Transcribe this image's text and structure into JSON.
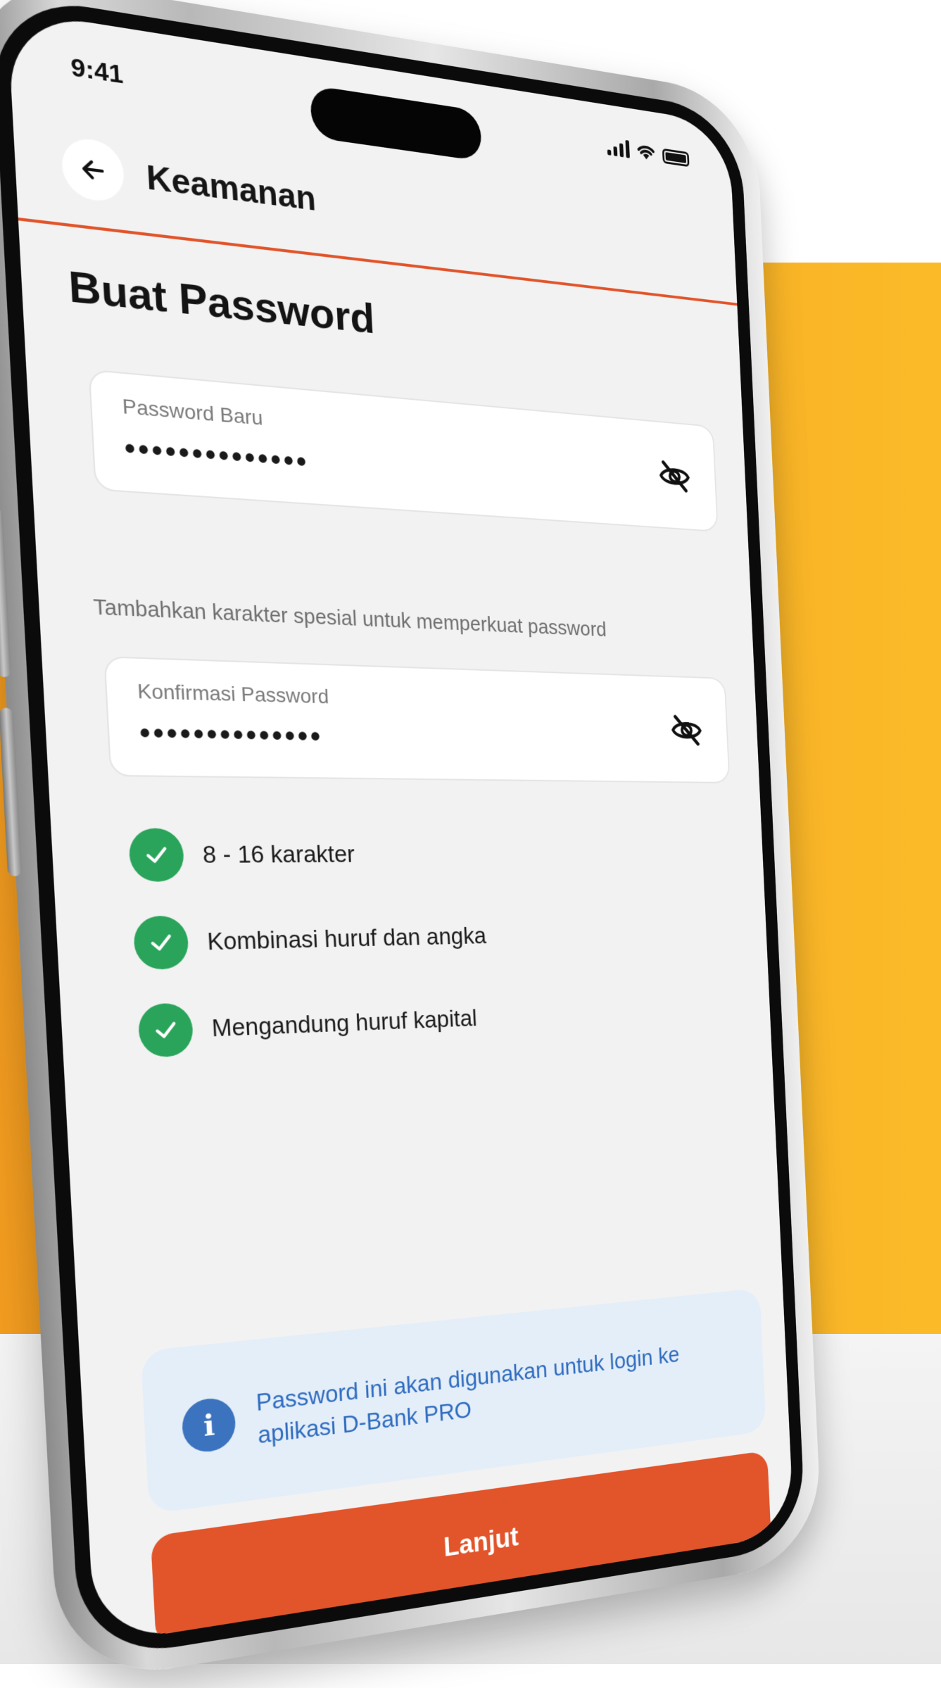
{
  "status_bar": {
    "time": "9:41"
  },
  "header": {
    "title": "Keamanan"
  },
  "page": {
    "title": "Buat Password"
  },
  "password_field": {
    "label": "Password Baru",
    "value": "••••••••••••••"
  },
  "hint": "Tambahkan karakter spesial untuk memperkuat password",
  "confirm_field": {
    "label": "Konfirmasi Password",
    "value": "••••••••••••••"
  },
  "rules": [
    {
      "text": "8 - 16 karakter",
      "met": true
    },
    {
      "text": "Kombinasi huruf dan angka",
      "met": true
    },
    {
      "text": "Mengandung huruf kapital",
      "met": true
    }
  ],
  "info": {
    "icon": "info-icon",
    "text": "Password ini akan digunakan untuk login ke aplikasi D-Bank PRO"
  },
  "cta": {
    "label": "Lanjut"
  },
  "colors": {
    "accent": "#e2542a",
    "success": "#2aa45a",
    "info": "#3b73bf",
    "background_band": "#f6a622"
  }
}
